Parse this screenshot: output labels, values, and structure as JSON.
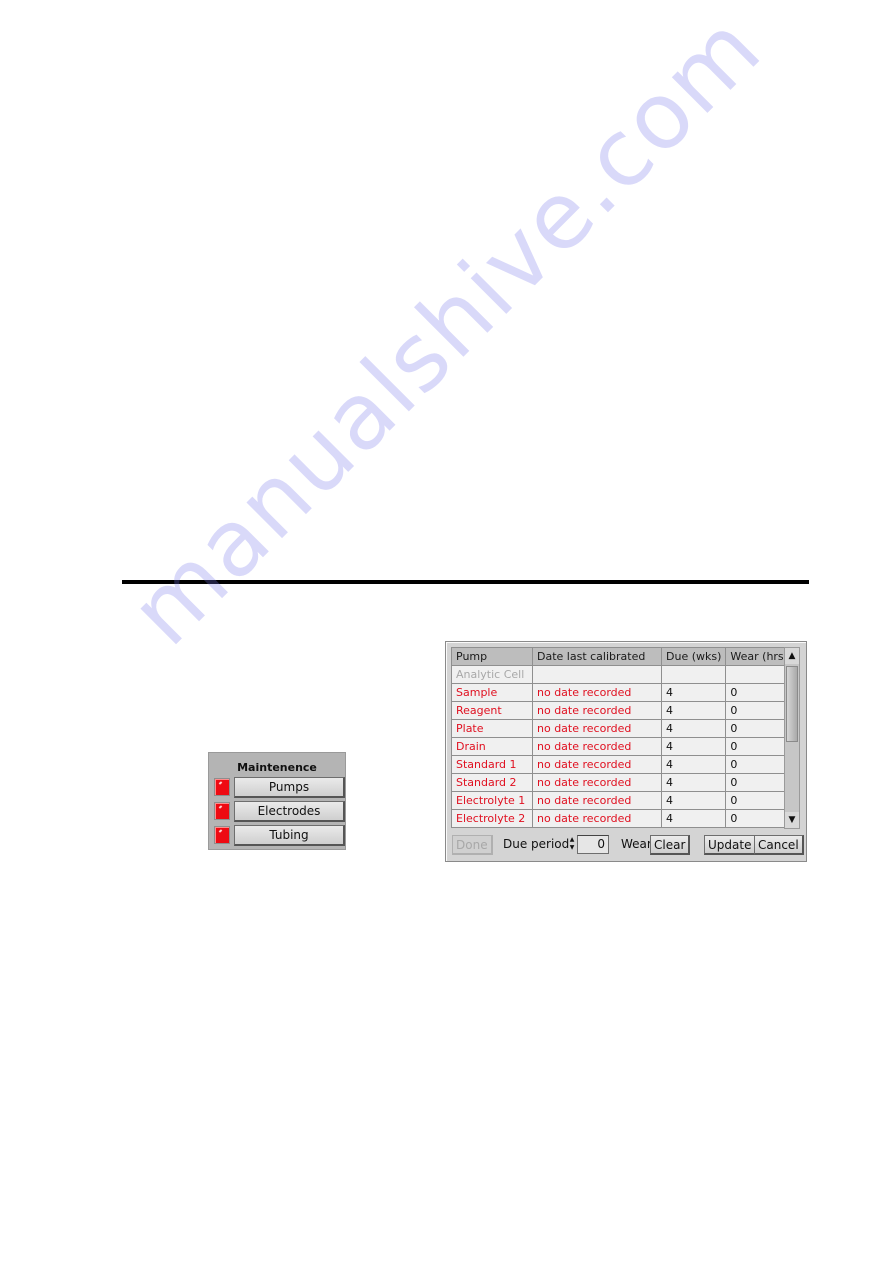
{
  "maintenance": {
    "title": "Maintenence",
    "buttons": [
      {
        "label": "Pumps",
        "indicator": "red"
      },
      {
        "label": "Electrodes",
        "indicator": "red"
      },
      {
        "label": "Tubing",
        "indicator": "red"
      }
    ]
  },
  "pump_table": {
    "columns": [
      "Pump",
      "Date last calibrated",
      "Due (wks)",
      "Wear (hrs)"
    ],
    "rows": [
      {
        "pump": "Analytic Cell",
        "date": "",
        "due": "",
        "wear": "",
        "state": "disabled"
      },
      {
        "pump": "Sample",
        "date": "no date recorded",
        "due": "4",
        "wear": "0",
        "state": "overdue"
      },
      {
        "pump": "Reagent",
        "date": "no date recorded",
        "due": "4",
        "wear": "0",
        "state": "overdue"
      },
      {
        "pump": "Plate",
        "date": "no date recorded",
        "due": "4",
        "wear": "0",
        "state": "overdue"
      },
      {
        "pump": "Drain",
        "date": "no date recorded",
        "due": "4",
        "wear": "0",
        "state": "overdue"
      },
      {
        "pump": "Standard 1",
        "date": "no date recorded",
        "due": "4",
        "wear": "0",
        "state": "overdue"
      },
      {
        "pump": "Standard 2",
        "date": "no date recorded",
        "due": "4",
        "wear": "0",
        "state": "overdue"
      },
      {
        "pump": "Electrolyte 1",
        "date": "no date recorded",
        "due": "4",
        "wear": "0",
        "state": "overdue"
      },
      {
        "pump": "Electrolyte 2",
        "date": "no date recorded",
        "due": "4",
        "wear": "0",
        "state": "overdue"
      }
    ],
    "scroll_up_icon": "▲",
    "scroll_down_icon": "▼"
  },
  "controls": {
    "done_label": "Done",
    "due_period_label": "Due period",
    "due_period_value": "0",
    "spin_up": "▲",
    "spin_down": "▼",
    "wear_label": "Wear",
    "clear_label": "Clear",
    "update_label": "Update",
    "cancel_label": "Cancel"
  },
  "colors": {
    "overdue_text": "#e01020",
    "disabled_text": "#a8a8a8",
    "indicator_red": "#ee0a12"
  },
  "watermark": "manualshive.com"
}
